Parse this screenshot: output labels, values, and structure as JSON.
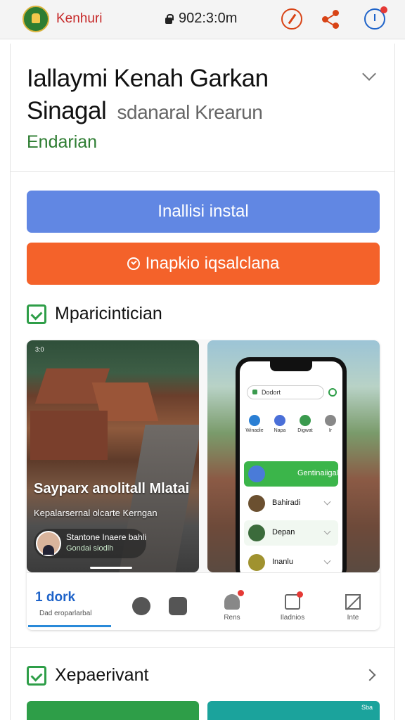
{
  "browser": {
    "site_name": "Kenhuri",
    "address": "902:3:0m"
  },
  "app": {
    "title_line1": "Iallaymi Kenah Garkan",
    "title_line2": "Sinagal",
    "title_line2_sub": "sdanaral Krearun",
    "category": "Endarian",
    "install_label": "Inallisi instal",
    "open_label": "Inapkio iqsalclana"
  },
  "sections": {
    "screenshots_heading": "Mparicintician",
    "second_heading": "Xepaerivant"
  },
  "gallery": {
    "left": {
      "status": "3:0",
      "caption": "Sayparx anolitall Mlatai",
      "caption_sub": "Kepalarsernal olcarte Kerngan",
      "chip_name": "Stantone Inaere bahli",
      "chip_sub": "Gondai siodlh"
    },
    "right": {
      "search_text": "Dodort",
      "tabs": [
        "Winadie",
        "Napa",
        "Digwat",
        "Ir"
      ],
      "rows": [
        "Gentinaiigal",
        "Bahiradi",
        "Depan",
        "Inanlu"
      ]
    },
    "nav": {
      "active_label": "dork",
      "active_prefix": "1",
      "active_sub": "Dad eroparlarbal",
      "items": [
        "Rens",
        "Iladnios",
        "Inte"
      ]
    }
  },
  "peek": {
    "left_stat": "",
    "right_stat": "Sba"
  },
  "colors": {
    "install": "#6187e3",
    "open": "#f4622a",
    "accent_green": "#2e9e48"
  }
}
